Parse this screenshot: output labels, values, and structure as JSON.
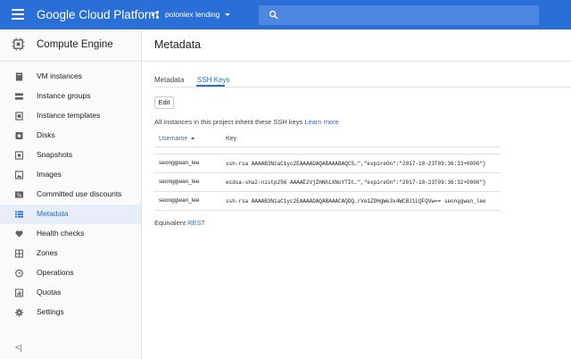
{
  "appbar": {
    "menu_icon": "hamburger-menu-icon",
    "brand": "Google Cloud Platform",
    "project_name": "poloniex lending",
    "search_icon": "search-icon",
    "color": "#2a6fd8"
  },
  "sidebar": {
    "product_icon": "chip-icon",
    "product_name": "Compute Engine",
    "items": [
      {
        "label": "VM instances",
        "icon": "vm-instances-icon"
      },
      {
        "label": "Instance groups",
        "icon": "instance-groups-icon"
      },
      {
        "label": "Instance templates",
        "icon": "instance-templates-icon"
      },
      {
        "label": "Disks",
        "icon": "disks-icon"
      },
      {
        "label": "Snapshots",
        "icon": "snapshots-icon"
      },
      {
        "label": "Images",
        "icon": "images-icon"
      },
      {
        "label": "Committed use discounts",
        "icon": "percent-icon"
      },
      {
        "label": "Metadata",
        "icon": "metadata-list-icon",
        "active": true
      },
      {
        "label": "Health checks",
        "icon": "health-checks-icon"
      },
      {
        "label": "Zones",
        "icon": "zones-grid-icon"
      },
      {
        "label": "Operations",
        "icon": "clock-icon"
      },
      {
        "label": "Quotas",
        "icon": "quotas-icon"
      },
      {
        "label": "Settings",
        "icon": "gear-icon"
      }
    ],
    "collapse_label": "<|"
  },
  "main": {
    "title": "Metadata",
    "tabs": [
      {
        "label": "Metadata",
        "active": false
      },
      {
        "label": "SSH Keys",
        "active": true
      }
    ],
    "edit_label": "Edit",
    "info_text": "All instances in this project inherit these SSH keys",
    "learn_more": "Learn more",
    "table": {
      "headers": {
        "username": "Username",
        "key": "Key"
      },
      "rows": [
        {
          "username": "seonggwan_lee",
          "key": "ssh-rsa AAAAB3NzaC1yc2EAAAADAQABAAABAQCS…\",\"expireOn\":\"2017-10-23T09:36:33+0000\"}"
        },
        {
          "username": "seonggwan_lee",
          "key": "ecdsa-sha2-nistp256 AAAAE2VjZHNhLXNoYTIt…\",\"expireOn\":\"2017-10-23T09:36:32+0000\"}"
        },
        {
          "username": "seonggwan_lee",
          "key": "ssh-rsa AAAAB3NzaC1yc2EAAAADAQABAAACAQDQ…rVe1ZDHgWe3x4WCBJ1LQFQVw== seonggwan_lee"
        }
      ]
    },
    "equivalent": "Equivalent",
    "rest": "REST"
  }
}
